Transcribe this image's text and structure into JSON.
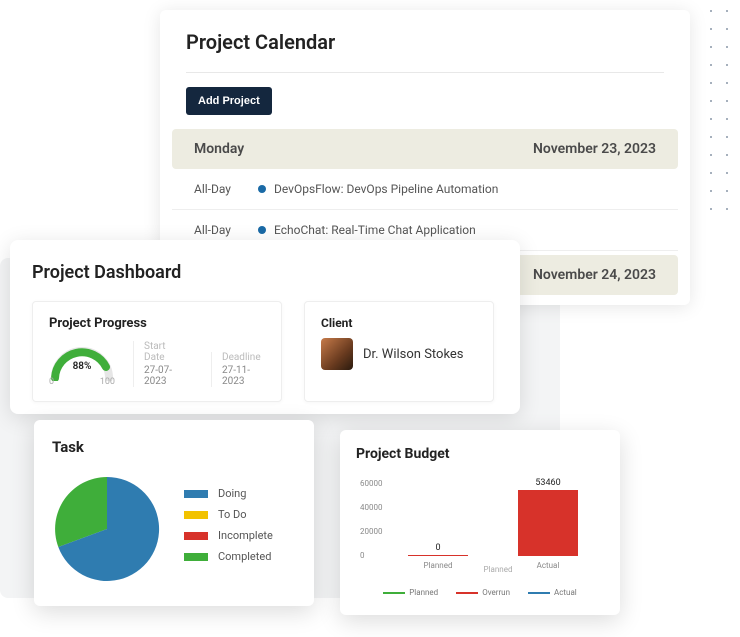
{
  "calendar": {
    "title": "Project Calendar",
    "add_button": "Add Project",
    "days": [
      {
        "dow": "Monday",
        "date": "November 23, 2023",
        "events": [
          {
            "timing": "All-Day",
            "title": "DevOpsFlow: DevOps Pipeline Automation"
          },
          {
            "timing": "All-Day",
            "title": "EchoChat: Real-Time Chat Application"
          }
        ]
      },
      {
        "dow": "",
        "date": "November 24, 2023",
        "events": []
      }
    ]
  },
  "dashboard": {
    "title": "Project Dashboard",
    "progress": {
      "title": "Project Progress",
      "percent_label": "88%",
      "scale_min": "0",
      "scale_max": "100",
      "start_label": "Start Date",
      "start_value": "27-07-2023",
      "deadline_label": "Deadline",
      "deadline_value": "27-11-2023"
    },
    "client": {
      "title": "Client",
      "name": "Dr. Wilson Stokes"
    }
  },
  "task": {
    "title": "Task",
    "legend": [
      "Doing",
      "To Do",
      "Incomplete",
      "Completed"
    ],
    "colors": [
      "#2f7cb0",
      "#f2c200",
      "#d7322a",
      "#3fae3a"
    ]
  },
  "budget": {
    "title": "Project Budget",
    "series_legend": [
      "Planned",
      "Overrun",
      "Actual"
    ],
    "series_colors": [
      "#3fae3a",
      "#d7322a",
      "#2f7cb0"
    ]
  },
  "chart_data": [
    {
      "type": "pie",
      "title": "Task",
      "series": [
        {
          "name": "Doing",
          "value": 65,
          "color": "#2f7cb0"
        },
        {
          "name": "To Do",
          "value": 0,
          "color": "#f2c200"
        },
        {
          "name": "Incomplete",
          "value": 0,
          "color": "#d7322a"
        },
        {
          "name": "Completed",
          "value": 35,
          "color": "#3fae3a"
        }
      ]
    },
    {
      "type": "bar",
      "title": "Project Budget",
      "categories": [
        "Planned",
        "Actual"
      ],
      "values": [
        0,
        53460
      ],
      "xlabel": "Planned",
      "ylabel": "",
      "ylim": [
        0,
        60000
      ],
      "yticks": [
        0,
        20000,
        40000,
        60000
      ]
    },
    {
      "type": "gauge",
      "title": "Project Progress",
      "value": 88,
      "range": [
        0,
        100
      ]
    }
  ]
}
